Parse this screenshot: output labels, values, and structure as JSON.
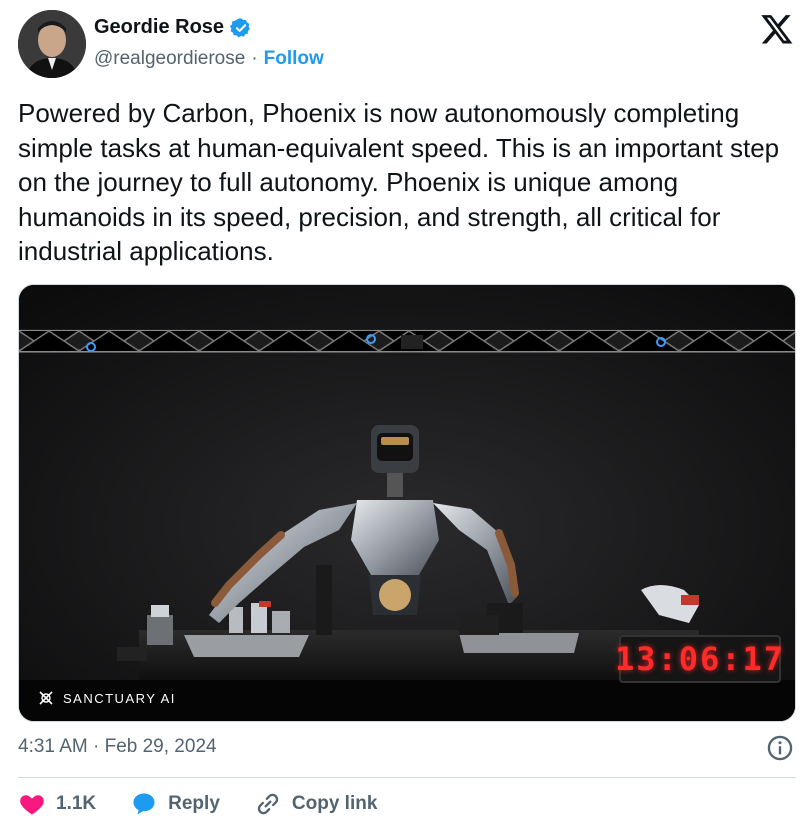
{
  "author": {
    "name": "Geordie Rose",
    "handle": "@realgeordierose",
    "separator": "·",
    "follow_label": "Follow",
    "avatar_icon": "avatar-photo",
    "verified_icon": "verified-badge-icon"
  },
  "tweet": {
    "text": "Powered by Carbon, Phoenix is now autonomously completing simple tasks at human-equivalent speed. This is an important step on the journey to full autonomy. Phoenix is unique among humanoids in its speed, precision, and strength, all critical for industrial applications."
  },
  "media": {
    "watermark": "SANCTUARY AI",
    "timer": "13:06:17"
  },
  "meta": {
    "timestamp": "4:31 AM · Feb 29, 2024"
  },
  "actions": {
    "like_count": "1.1K",
    "reply_label": "Reply",
    "copy_link_label": "Copy link"
  },
  "colors": {
    "accent": "#1d9bf0",
    "like": "#f91880",
    "text": "#0f1419",
    "muted": "#536471"
  }
}
